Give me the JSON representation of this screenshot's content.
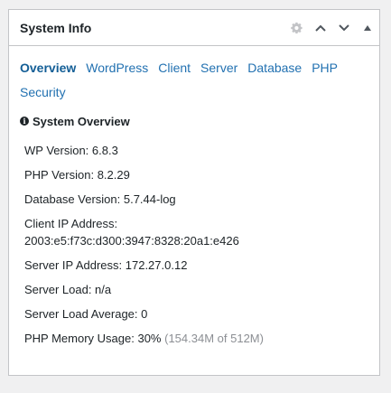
{
  "widget": {
    "title": "System Info"
  },
  "tabs": [
    {
      "label": "Overview",
      "active": true
    },
    {
      "label": "WordPress",
      "active": false
    },
    {
      "label": "Client",
      "active": false
    },
    {
      "label": "Server",
      "active": false
    },
    {
      "label": "Database",
      "active": false
    },
    {
      "label": "PHP",
      "active": false
    },
    {
      "label": "Security",
      "active": false
    }
  ],
  "overview": {
    "heading": "System Overview",
    "wp_version": "WP Version: 6.8.3",
    "php_version": "PHP Version: 8.2.29",
    "db_version": "Database Version: 5.7.44-log",
    "client_ip_label": "Client IP Address:",
    "client_ip_value": "2003:e5:f73c:d300:3947:8328:20a1:e426",
    "server_ip": "Server IP Address: 172.27.0.12",
    "server_load": "Server Load: n/a",
    "server_load_avg": "Server Load Average: 0",
    "php_memory": "PHP Memory Usage: 30%",
    "php_memory_detail": "(154.34M of 512M)"
  },
  "icons": {
    "gear": "gear-icon",
    "up": "chevron-up-icon",
    "down": "chevron-down-icon",
    "toggle": "triangle-up-icon",
    "info": "info-icon"
  },
  "colors": {
    "link": "#2271b1",
    "active_link": "#135e96",
    "text": "#1d2327",
    "muted": "#8c8f94",
    "border": "#c3c4c7",
    "background": "#f0f0f1"
  }
}
